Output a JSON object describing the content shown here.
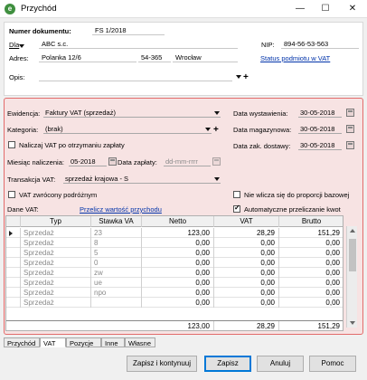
{
  "window": {
    "title": "Przychód",
    "minimize": "—",
    "maximize": "☐",
    "close": "✕"
  },
  "header": {
    "doc_number_label": "Numer dokumentu:",
    "doc_number": "FS 1/2018",
    "dla_label": "Dla",
    "contractor_name": "ABC s.c.",
    "nip_label": "NIP:",
    "nip_value": "894-56-53-563",
    "adres_label": "Adres:",
    "street": "Polanka  12/6",
    "postal_code": "54-365",
    "city": "Wrocław",
    "vat_status_link": "Status podmiotu w VAT",
    "opis_label": "Opis:",
    "opis_value": "",
    "plus": "+"
  },
  "details": {
    "ewidencja_label": "Ewidencja:",
    "ewidencja_value": "Faktury VAT (sprzedaż)",
    "kategoria_label": "Kategoria:",
    "kategoria_value": "(brak)",
    "plus": "+",
    "naliczaj_label": "Naliczaj VAT po otrzymaniu zapłaty",
    "miesiac_label": "Miesiąc naliczenia:",
    "miesiac_value": "05-2018",
    "data_zaplaty_label": "Data zapłaty:",
    "data_zaplaty_placeholder": "dd-mm-rrrr",
    "transakcja_label": "Transakcja VAT:",
    "transakcja_value": "sprzedaż krajowa - S",
    "vat_zwrocony_label": "VAT zwrócony podróżnym",
    "nie_wlicza_label": "Nie wlicza się do proporcji bazowej",
    "dane_vat_label": "Dane VAT:",
    "przelicz_link": "Przelicz wartość przychodu",
    "auto_przelicz_label": "Automatyczne przeliczanie kwot",
    "data_wystawienia_label": "Data wystawienia:",
    "data_wystawienia": "30-05-2018",
    "data_magazynowa_label": "Data magazynowa:",
    "data_magazynowa": "30-05-2018",
    "data_zak_label": "Data zak. dostawy:",
    "data_zak": "30-05-2018"
  },
  "vat_table": {
    "columns": [
      "Typ",
      "Stawka VA",
      "Netto",
      "VAT",
      "Brutto"
    ],
    "rows": [
      {
        "typ": "Sprzedaż",
        "stawka": "23",
        "netto": "123,00",
        "vat": "28,29",
        "brutto": "151,29"
      },
      {
        "typ": "Sprzedaż",
        "stawka": "8",
        "netto": "0,00",
        "vat": "0,00",
        "brutto": "0,00"
      },
      {
        "typ": "Sprzedaż",
        "stawka": "5",
        "netto": "0,00",
        "vat": "0,00",
        "brutto": "0,00"
      },
      {
        "typ": "Sprzedaż",
        "stawka": "0",
        "netto": "0,00",
        "vat": "0,00",
        "brutto": "0,00"
      },
      {
        "typ": "Sprzedaż",
        "stawka": "zw",
        "netto": "0,00",
        "vat": "0,00",
        "brutto": "0,00"
      },
      {
        "typ": "Sprzedaż",
        "stawka": "ue",
        "netto": "0,00",
        "vat": "0,00",
        "brutto": "0,00"
      },
      {
        "typ": "Sprzedaż",
        "stawka": "npo",
        "netto": "0,00",
        "vat": "0,00",
        "brutto": "0,00"
      },
      {
        "typ": "Sprzedaż",
        "stawka": "",
        "netto": "0,00",
        "vat": "0,00",
        "brutto": "0,00"
      }
    ],
    "totals": {
      "netto": "123,00",
      "vat": "28,29",
      "brutto": "151,29"
    }
  },
  "tabs": [
    "Przychód",
    "VAT",
    "Pozycje",
    "Inne",
    "Własne"
  ],
  "buttons": {
    "zapisz_kontynuuj": "Zapisz i kontynuuj",
    "zapisz": "Zapisz",
    "anuluj": "Anuluj",
    "pomoc": "Pomoc"
  }
}
